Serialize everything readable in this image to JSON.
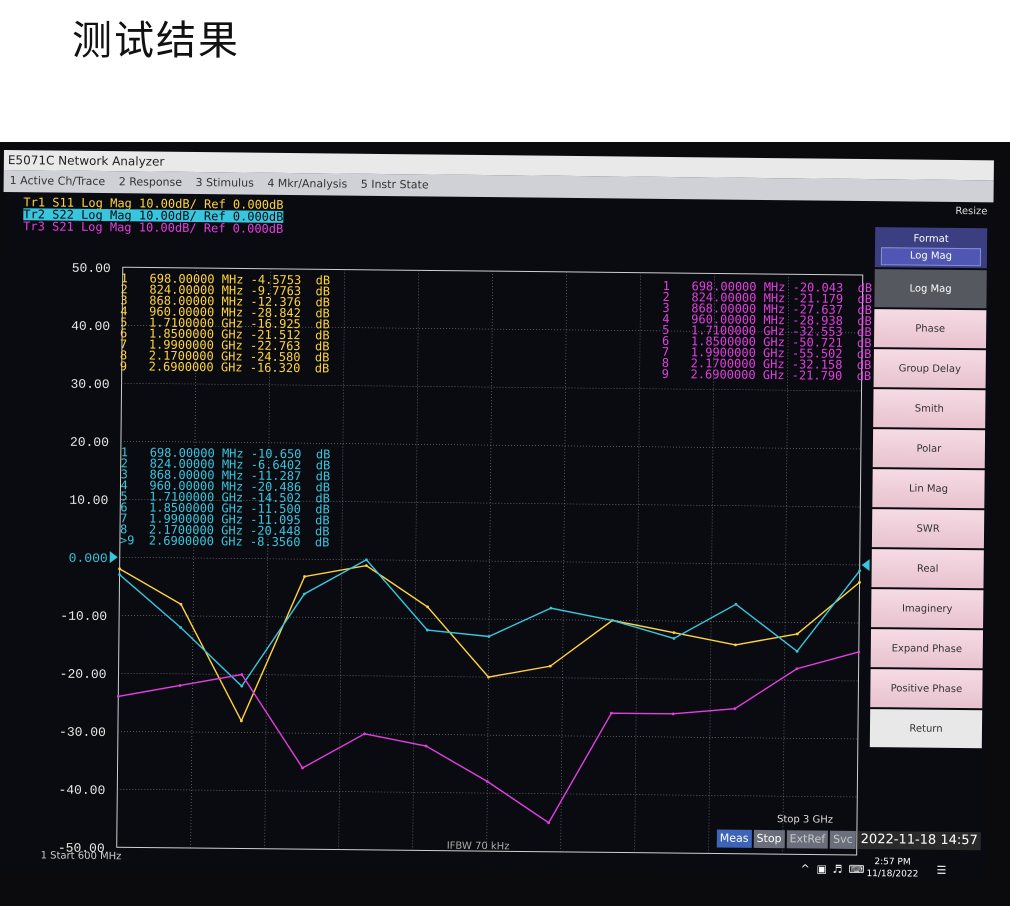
{
  "heading": "测试结果",
  "window_title": "E5071C Network Analyzer",
  "menu": [
    "1 Active Ch/Trace",
    "2 Response",
    "3 Stimulus",
    "4 Mkr/Analysis",
    "5 Instr State"
  ],
  "resize_label": "Resize",
  "traces": [
    {
      "label": "Tr1 S11 Log Mag 10.00dB/ Ref 0.000dB",
      "color": "#ffd43b"
    },
    {
      "label": "Tr2 S22 Log Mag 10.00dB/ Ref 0.000dB",
      "color": "#38c6de"
    },
    {
      "label": "Tr3 S21 Log Mag 10.00dB/ Ref 0.000dB",
      "color": "#e23fe0"
    }
  ],
  "y_ticks": [
    "50.00",
    "40.00",
    "30.00",
    "20.00",
    "10.00",
    "0.000",
    "-10.00",
    "-20.00",
    "-30.00",
    "-40.00",
    "-50.00"
  ],
  "markers_s11": [
    "1   698.00000 MHz -4.5753  dB",
    "2   824.00000 MHz -9.7763  dB",
    "3   868.00000 MHz -12.376  dB",
    "4   960.00000 MHz -28.842  dB",
    "5   1.7100000 GHz -16.925  dB",
    "6   1.8500000 GHz -21.512  dB",
    "7   1.9900000 GHz -22.763  dB",
    "8   2.1700000 GHz -24.580  dB",
    "9   2.6900000 GHz -16.320  dB"
  ],
  "markers_s22": [
    "1   698.00000 MHz -10.650  dB",
    "2   824.00000 MHz -6.6402  dB",
    "3   868.00000 MHz -11.287  dB",
    "4   960.00000 MHz -20.486  dB",
    "5   1.7100000 GHz -14.502  dB",
    "6   1.8500000 GHz -11.500  dB",
    "7   1.9900000 GHz -11.095  dB",
    "8   2.1700000 GHz -20.448  dB",
    ">9  2.6900000 GHz -8.3560  dB"
  ],
  "markers_s21": [
    "1   698.00000 MHz -20.043  dB",
    "2   824.00000 MHz -21.179  dB",
    "3   868.00000 MHz -27.637  dB",
    "4   960.00000 MHz -28.938  dB",
    "5   1.7100000 GHz -32.553  dB",
    "6   1.8500000 GHz -50.721  dB",
    "7   1.9900000 GHz -55.502  dB",
    "8   2.1700000 GHz -32.158  dB",
    "9   2.6900000 GHz -21.790  dB"
  ],
  "softkeys": {
    "header": "Format",
    "header_value": "Log Mag",
    "items": [
      "Log Mag",
      "Phase",
      "Group Delay",
      "Smith",
      "Polar",
      "Lin Mag",
      "SWR",
      "Real",
      "Imaginery",
      "Expand Phase",
      "Positive Phase",
      "Return"
    ]
  },
  "start_label": "1  Start 600 MHz",
  "stop_label": "Stop 3 GHz",
  "ifbw_label": "IFBW 70 kHz",
  "status": {
    "meas": "Meas",
    "stop": "Stop",
    "extref": "ExtRef",
    "svc": "Svc",
    "datetime": "2022-11-18 14:57"
  },
  "taskbar": {
    "time": "2:57 PM",
    "date": "11/18/2022"
  },
  "chart_data": {
    "type": "line",
    "x": [
      0.6,
      0.8,
      1.0,
      1.2,
      1.4,
      1.6,
      1.8,
      2.0,
      2.2,
      2.4,
      2.6,
      2.8,
      3.0
    ],
    "x_unit": "GHz",
    "ylim": [
      -50,
      50
    ],
    "series": [
      {
        "name": "S11",
        "values": [
          -2,
          -8,
          -28,
          -3,
          -1,
          -8,
          -20,
          -18,
          -10,
          -12,
          -14,
          -12,
          -3
        ]
      },
      {
        "name": "S22",
        "values": [
          -3,
          -12,
          -22,
          -6,
          0,
          -12,
          -13,
          -8,
          -10,
          -13,
          -7,
          -15,
          -1
        ]
      },
      {
        "name": "S21",
        "values": [
          -24,
          -22,
          -20,
          -36,
          -30,
          -32,
          -38,
          -45,
          -26,
          -26,
          -25,
          -18,
          -15
        ]
      }
    ]
  }
}
